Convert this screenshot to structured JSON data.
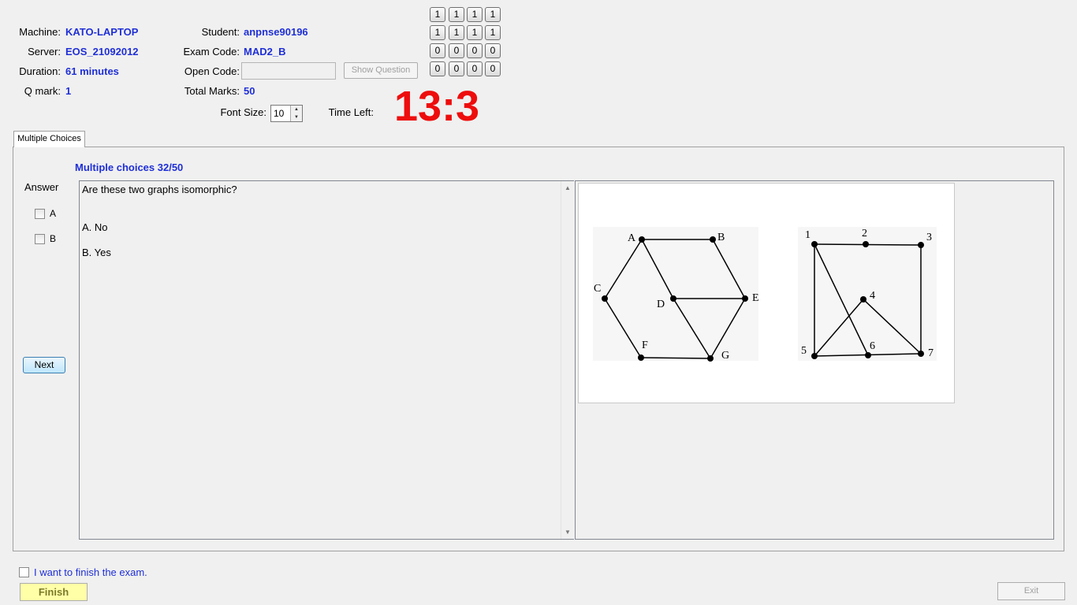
{
  "info": {
    "machine_label": "Machine:",
    "machine": "KATO-LAPTOP",
    "server_label": "Server:",
    "server": "EOS_21092012",
    "duration_label": "Duration:",
    "duration": "61 minutes",
    "qmark_label": "Q mark:",
    "qmark": "1",
    "student_label": "Student:",
    "student": "anpnse90196",
    "exam_code_label": "Exam Code:",
    "exam_code": "MAD2_B",
    "open_code_label": "Open Code:",
    "open_code_value": "",
    "show_question_label": "Show Question",
    "total_marks_label": "Total Marks:",
    "total_marks": "50",
    "font_size_label": "Font Size:",
    "font_size": "10",
    "time_left_label": "Time Left:",
    "time_left": "13:3"
  },
  "digit_grid": [
    [
      "1",
      "1",
      "1",
      "1"
    ],
    [
      "1",
      "1",
      "1",
      "1"
    ],
    [
      "0",
      "0",
      "0",
      "0"
    ],
    [
      "0",
      "0",
      "0",
      "0"
    ]
  ],
  "tab": {
    "label": "Multiple Choices"
  },
  "question": {
    "header": "Multiple choices 32/50",
    "answer_label": "Answer",
    "choices": [
      "A",
      "B"
    ],
    "next_label": "Next",
    "text": "Are these two graphs isomorphic?",
    "options": [
      "A. No",
      "B. Yes"
    ]
  },
  "graph_image": {
    "left_graph_labels": [
      "A",
      "B",
      "C",
      "D",
      "E",
      "F",
      "G"
    ],
    "right_graph_labels": [
      "1",
      "2",
      "3",
      "4",
      "5",
      "6",
      "7"
    ]
  },
  "footer": {
    "finish_check_label": "I want to finish the exam.",
    "finish_label": "Finish",
    "exit_label": "Exit"
  }
}
